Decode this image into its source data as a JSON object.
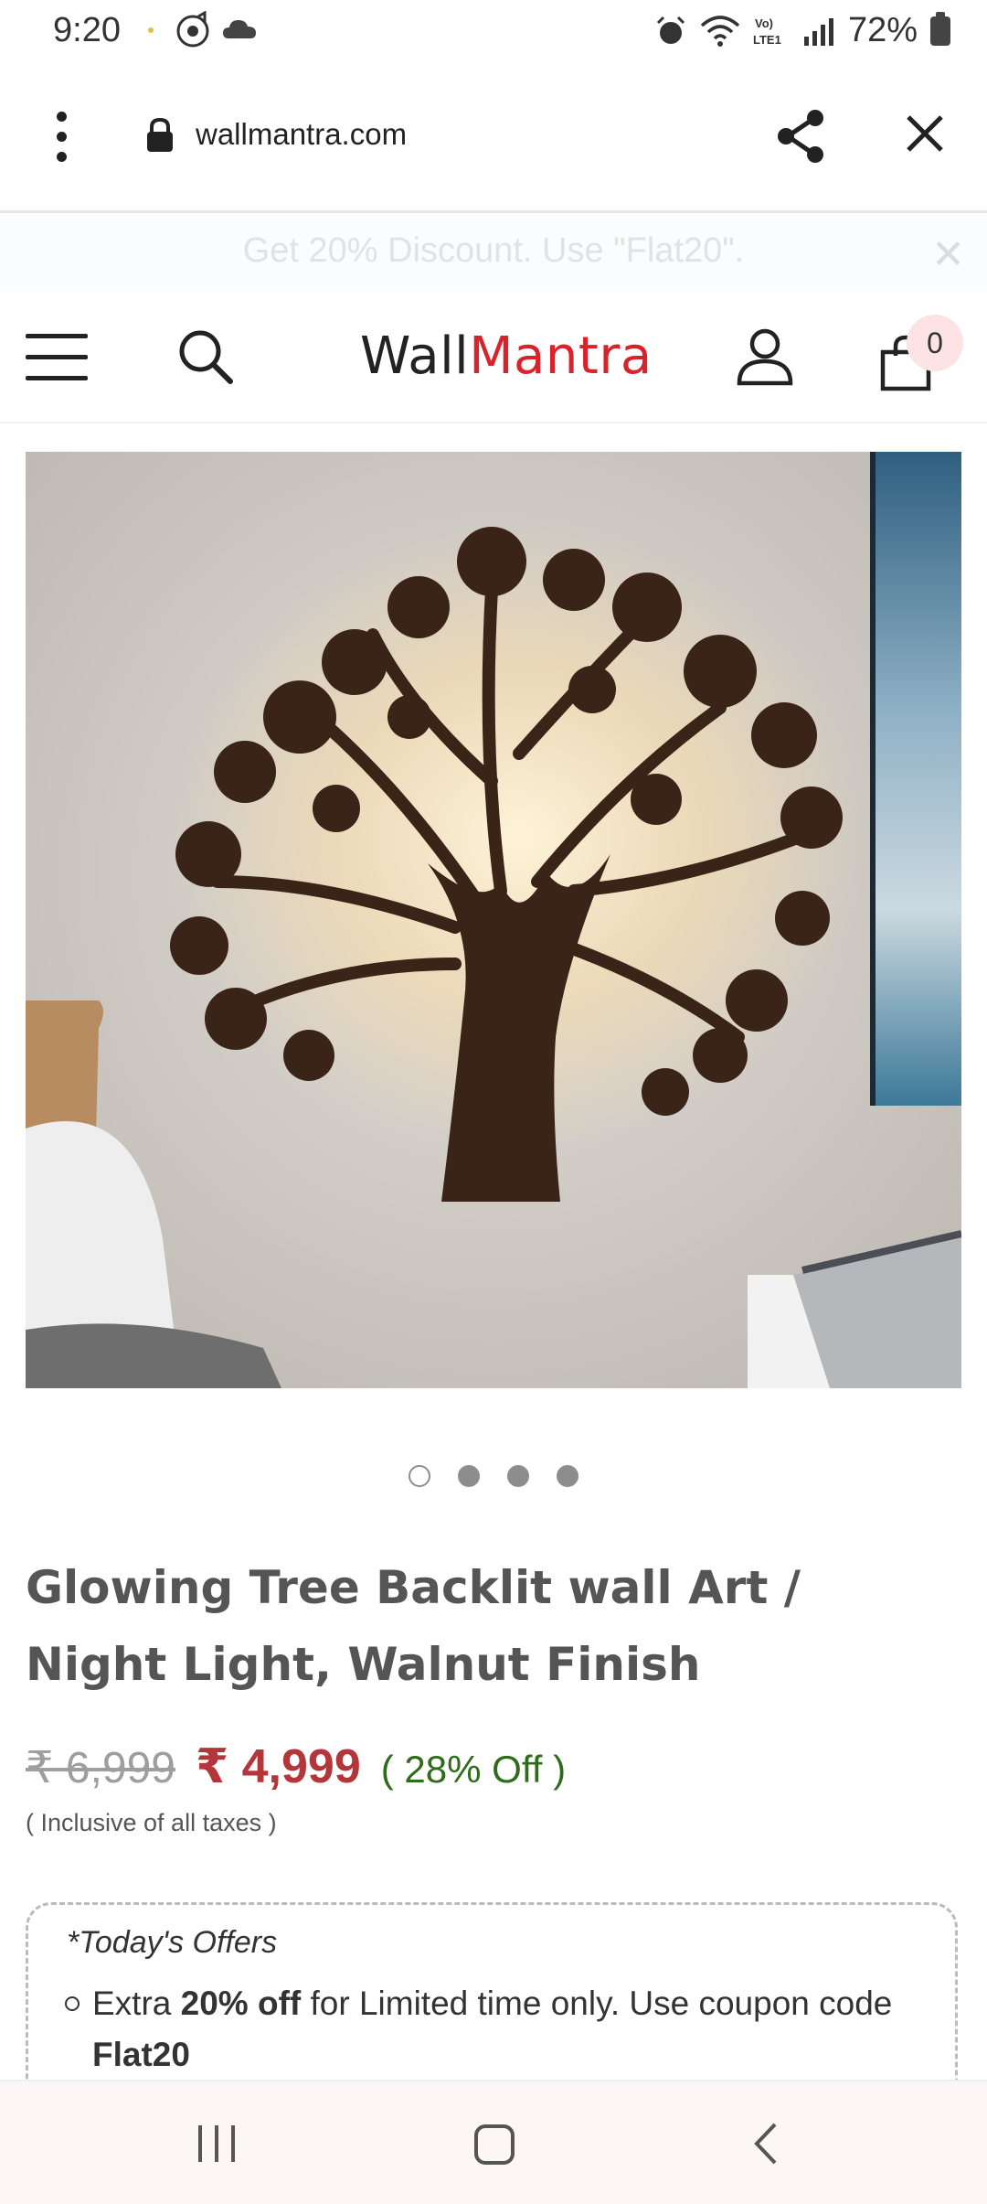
{
  "status": {
    "time": "9:20",
    "battery": "72%",
    "icons": [
      "music-icon",
      "cloud-icon",
      "alarm-icon",
      "wifi-icon",
      "volte-icon",
      "signal-icon",
      "battery-icon"
    ]
  },
  "browser": {
    "url": "wallmantra.com",
    "icons": [
      "more-options-icon",
      "lock-icon",
      "share-icon",
      "close-icon"
    ]
  },
  "promo": {
    "text": "Get 20% Discount. Use \"Flat20\".",
    "close": "✕"
  },
  "header": {
    "logo_part1": "Wall",
    "logo_part2": "Mantra",
    "cart_count": "0",
    "colors": {
      "brand_red": "#d8232a"
    }
  },
  "product": {
    "carousel": {
      "total": 4,
      "active_index": 0
    },
    "title": "Glowing Tree Backlit wall Art / Night Light, Walnut Finish",
    "old_price": "₹ 6,999",
    "new_price": "₹ 4,999",
    "discount": "( 28% Off )",
    "tax_note": "( Inclusive of all taxes )",
    "colors": {
      "price_red": "#b3363a",
      "discount_green": "#2e6b1a"
    }
  },
  "offers": {
    "title": "*Today's Offers",
    "item": {
      "part1": "Extra ",
      "bold1": "20% off",
      "part2": " for Limited time only. Use coupon code ",
      "bold2": "Flat20"
    }
  }
}
